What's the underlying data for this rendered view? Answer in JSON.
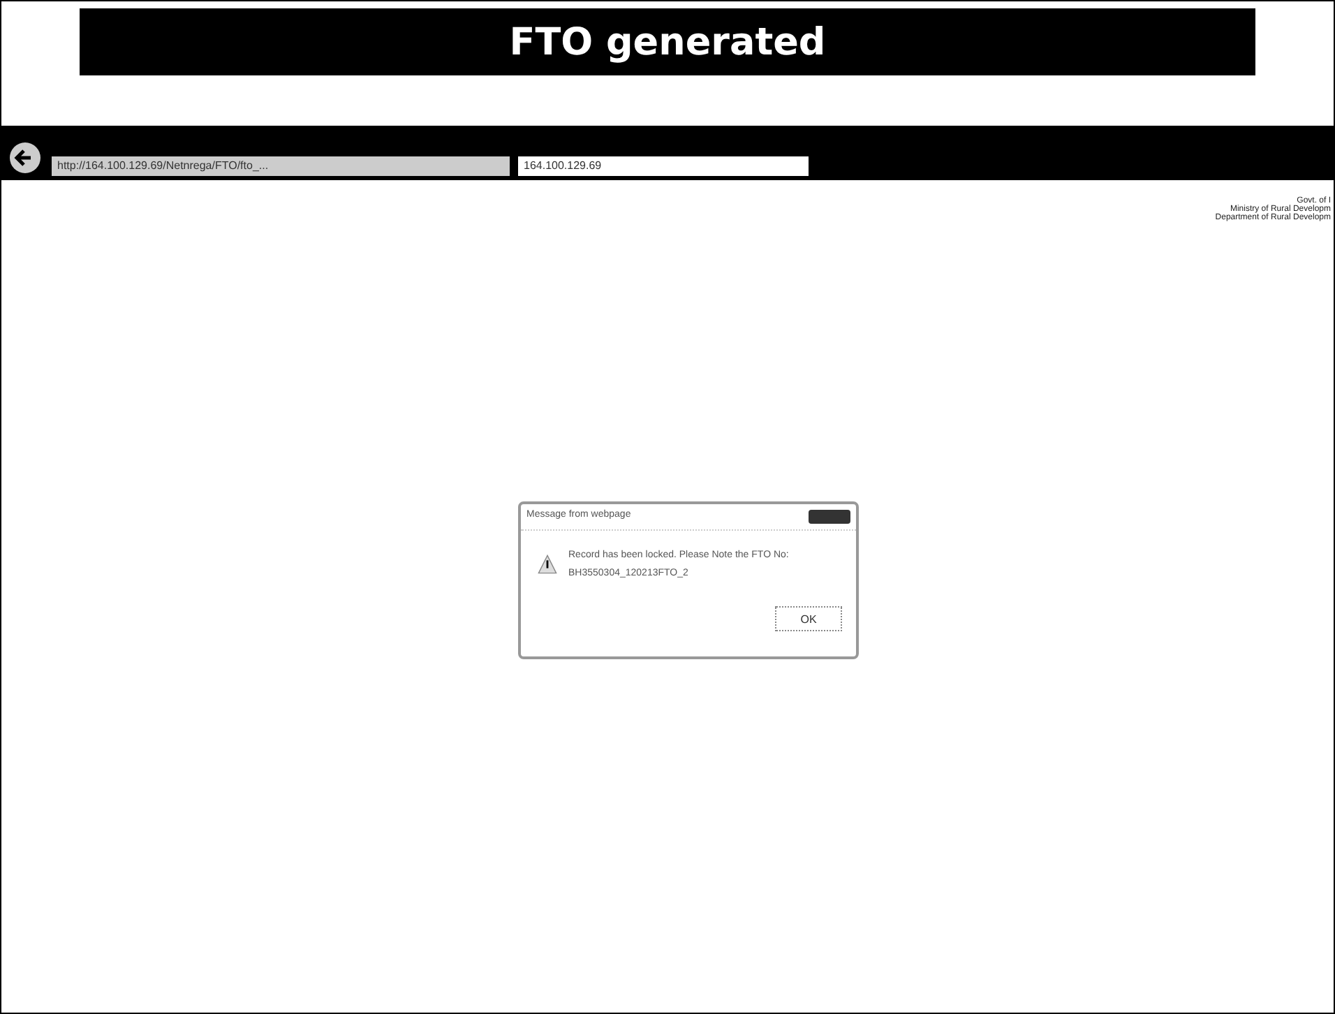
{
  "slide": {
    "title": "FTO generated"
  },
  "browser": {
    "address": "http://164.100.129.69/Netnrega/FTO/fto_...",
    "tab": "164.100.129.69"
  },
  "header_lines": [
    "Govt. of I",
    "Ministry of Rural Developm",
    "Department of Rural Developm"
  ],
  "dialog": {
    "title": "Message from webpage",
    "message": "Record has been locked. Please Note the FTO No:",
    "fto_number": "BH3550304_120213FTO_2",
    "button": "OK"
  }
}
